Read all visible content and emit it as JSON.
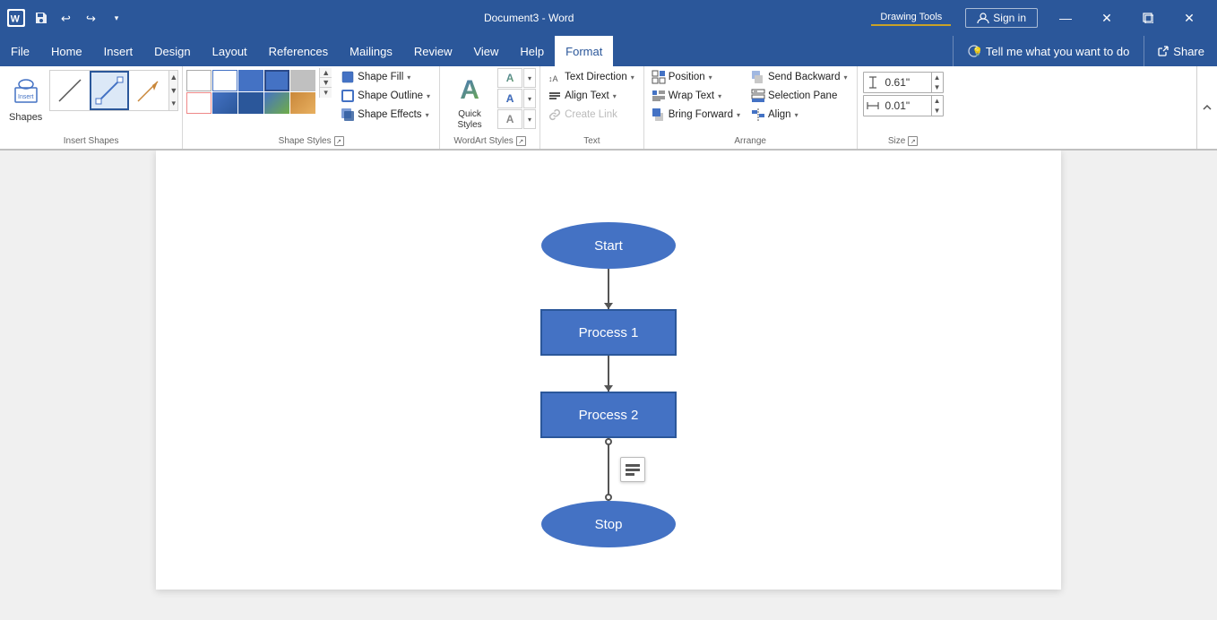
{
  "titlebar": {
    "title": "Document3 - Word",
    "drawing_tools": "Drawing Tools",
    "save_label": "💾",
    "undo_label": "↩",
    "redo_label": "↪",
    "more_label": "▾",
    "sign_in": "Sign in",
    "share": "Share",
    "minimize": "🗕",
    "maximize": "🗖",
    "close": "✕"
  },
  "menubar": {
    "items": [
      "File",
      "Home",
      "Insert",
      "Design",
      "Layout",
      "References",
      "Mailings",
      "Review",
      "View",
      "Help",
      "Format"
    ],
    "active": "Format",
    "tell_me": "Tell me what you want to do",
    "share": "Share"
  },
  "ribbon": {
    "groups": [
      {
        "id": "insert-shapes",
        "label": "Insert Shapes",
        "shapes_label": "Shapes"
      },
      {
        "id": "shape-styles",
        "label": "Shape Styles",
        "buttons": [
          "Shape Fill",
          "Shape Outline",
          "Shape Effects"
        ]
      },
      {
        "id": "wordart-styles",
        "label": "WordArt Styles",
        "buttons": [
          "Quick Styles"
        ]
      },
      {
        "id": "text",
        "label": "Text",
        "buttons": [
          "Text Direction",
          "Align Text",
          "Create Link"
        ]
      },
      {
        "id": "arrange",
        "label": "Arrange",
        "buttons": [
          "Position",
          "Wrap Text",
          "Bring Forward",
          "Send Backward",
          "Selection Pane",
          "Align"
        ]
      },
      {
        "id": "size",
        "label": "Size",
        "height_label": "0.61\"",
        "width_label": "0.01\""
      }
    ]
  },
  "flowchart": {
    "nodes": [
      {
        "id": "start",
        "type": "ellipse",
        "label": "Start"
      },
      {
        "id": "process1",
        "type": "rect",
        "label": "Process 1"
      },
      {
        "id": "process2",
        "type": "rect",
        "label": "Process 2",
        "selected": true
      },
      {
        "id": "stop",
        "type": "ellipse",
        "label": "Stop"
      }
    ]
  },
  "icons": {
    "shapes": "⬡",
    "shape_fill": "🔵",
    "shape_outline": "⬜",
    "shape_effects": "✨",
    "wordart": "A",
    "text_direction": "↕",
    "align_text": "≡",
    "create_link": "🔗",
    "position": "⊞",
    "wrap_text": "⊡",
    "bring_forward": "⬆",
    "send_backward": "⬇",
    "selection_pane": "≣",
    "align": "⊟",
    "height_icon": "↕",
    "width_icon": "↔",
    "caret": "▾",
    "up_arrow": "▲",
    "down_arrow": "▼",
    "layout_icon": "≡"
  }
}
